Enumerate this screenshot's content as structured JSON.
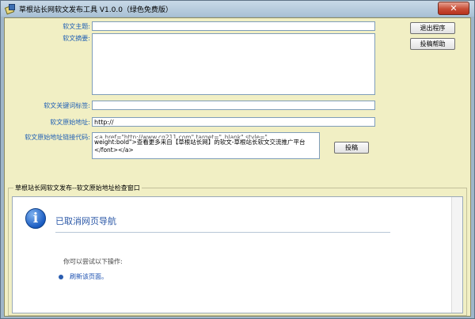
{
  "window": {
    "title": "草根站长网软文发布工具 V1.0.0（绿色免费版）",
    "close_symbol": "✕"
  },
  "form": {
    "subject_label": "软文主题:",
    "summary_label": "软文摘要:",
    "keywords_label": "软文关键词标签:",
    "source_url_label": "软文原始地址:",
    "source_url_value": "http://",
    "link_code_label": "软文原始地址链接代码:",
    "link_code_lines": [
      "<a href=\"http://www.cg211.com\" target=\"_blank\" style=\"",
      "weight:bold\">查看更多来自【草根站长网】的软文-草根站长软文交流推广平台",
      "</font></a>"
    ]
  },
  "buttons": {
    "exit": "退出程序",
    "help": "投稿帮助",
    "submit": "投稿"
  },
  "check_panel": {
    "title": "草根站长网软文发布--软文原始地址检查窗口",
    "icon_glyph": "i",
    "nav_title": "已取消网页导航",
    "hint": "你可以尝试以下操作:",
    "refresh_link": "刷新该页面。"
  }
}
